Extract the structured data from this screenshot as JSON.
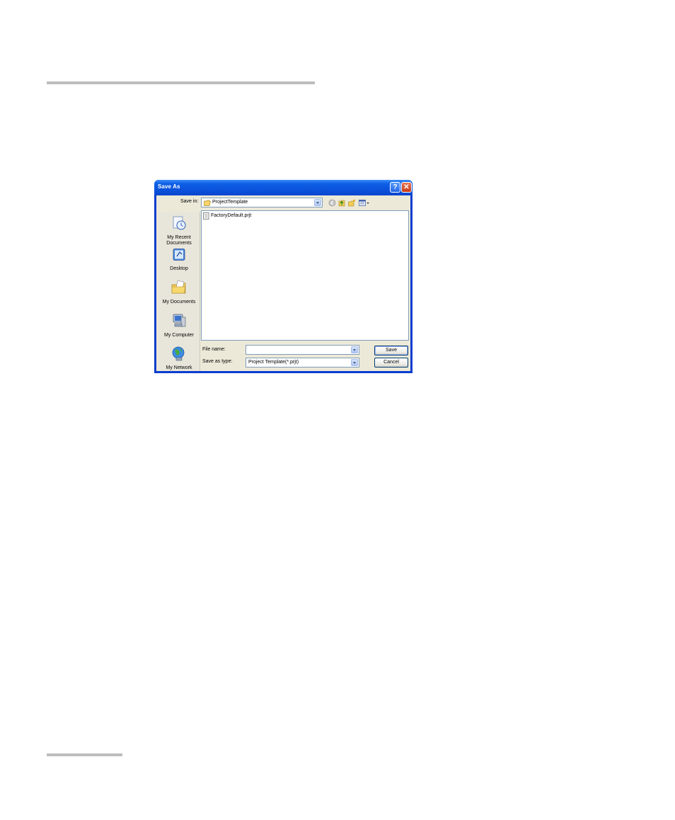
{
  "dialog": {
    "title": "Save As",
    "help_button": "?",
    "close_button": "✕"
  },
  "toolbar": {
    "save_in_label": "Save in:",
    "save_in_value": "ProjectTemplate"
  },
  "places": [
    {
      "label": "My Recent Documents",
      "icon": "recent-documents-icon"
    },
    {
      "label": "Desktop",
      "icon": "desktop-icon"
    },
    {
      "label": "My Documents",
      "icon": "my-documents-icon"
    },
    {
      "label": "My Computer",
      "icon": "my-computer-icon"
    },
    {
      "label": "My Network",
      "icon": "my-network-icon"
    }
  ],
  "files": [
    {
      "name": "FactoryDefault.prjt",
      "icon": "document-icon"
    }
  ],
  "form": {
    "file_name_label": "File name:",
    "file_name_value": "",
    "save_as_type_label": "Save as type:",
    "save_as_type_value": "Project Template(*.prjt)"
  },
  "buttons": {
    "save": "Save",
    "cancel": "Cancel"
  },
  "colors": {
    "titlebar": "#0b53dc",
    "client": "#ece9d8",
    "border": "#7f9db9"
  }
}
